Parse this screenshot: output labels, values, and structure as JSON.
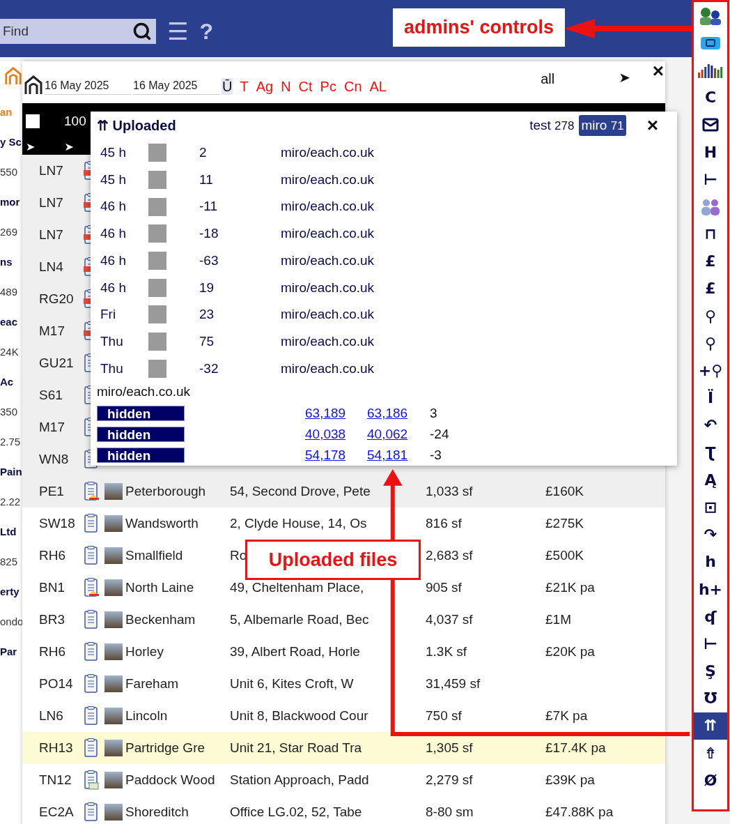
{
  "top_bar": {
    "search": {
      "placeholder": "Find"
    },
    "menu_glyph": "☰",
    "help_glyph": "?"
  },
  "annotations": [
    {
      "kind": "admins",
      "text": "admins' controls"
    },
    {
      "kind": "uploads",
      "text": "Uploaded files"
    }
  ],
  "left_strip": [
    {
      "kind": "accent",
      "text": "an"
    },
    {
      "kind": "heading",
      "text": "y Sc"
    },
    {
      "kind": "value",
      "text": "550"
    },
    {
      "kind": "heading",
      "text": "mor"
    },
    {
      "kind": "value",
      "text": "269"
    },
    {
      "kind": "heading",
      "text": "ns"
    },
    {
      "kind": "value",
      "text": "489"
    },
    {
      "kind": "heading",
      "text": "eac"
    },
    {
      "kind": "value",
      "text": "24K"
    },
    {
      "kind": "heading",
      "text": "Ac"
    },
    {
      "kind": "value",
      "text": "350"
    },
    {
      "kind": "value",
      "text": "2.75"
    },
    {
      "kind": "heading",
      "text": "Pain"
    },
    {
      "kind": "value",
      "text": "2.22"
    },
    {
      "kind": "heading",
      "text": "Ltd"
    },
    {
      "kind": "value",
      "text": "825"
    },
    {
      "kind": "heading",
      "text": "erty"
    },
    {
      "kind": "value",
      "text": "ondo"
    },
    {
      "kind": "heading",
      "text": "Par"
    }
  ],
  "panel": {
    "date_from": "16 May 2025",
    "date_to": "16 May 2025",
    "filters": [
      {
        "label": "Ū",
        "selected": true
      },
      {
        "label": "T",
        "selected": false
      },
      {
        "label": "Ag",
        "selected": false
      },
      {
        "label": "N",
        "selected": false
      },
      {
        "label": "Ct",
        "selected": false
      },
      {
        "label": "Pc",
        "selected": false
      },
      {
        "label": "Cn",
        "selected": false
      },
      {
        "label": "AL",
        "selected": false
      }
    ],
    "scope": "all",
    "go_glyph": "➤",
    "close_glyph": "×",
    "toolbar": {
      "checked": false,
      "count": "100",
      "arrows": [
        "➤",
        "➤"
      ]
    }
  },
  "table": {
    "rows": [
      {
        "postcode": "LN7",
        "kind": "pdf",
        "color": "#efefef"
      },
      {
        "postcode": "LN7",
        "kind": "pdf",
        "color": "#efefef"
      },
      {
        "postcode": "LN7",
        "kind": "pdf",
        "color": "#efefef"
      },
      {
        "postcode": "LN4",
        "kind": "pdf",
        "color": "#efefef"
      },
      {
        "postcode": "RG20",
        "kind": "pdf",
        "color": "#efefef"
      },
      {
        "postcode": "M17",
        "kind": "pdf",
        "color": "#efefef"
      },
      {
        "postcode": "GU21",
        "kind": "plain",
        "color": "#efefef"
      },
      {
        "postcode": "S61",
        "kind": "plain",
        "color": "#efefef"
      },
      {
        "postcode": "M17",
        "kind": "plain",
        "color": "#efefef"
      },
      {
        "postcode": "WN8",
        "kind": "plain",
        "color": "#efefef"
      },
      {
        "postcode": "PE1",
        "kind": "epc",
        "color": "#efefef",
        "town": "Peterborough",
        "address": "54, Second Drove, Pete",
        "size": "1,033 sf",
        "price": "£160K"
      },
      {
        "postcode": "SW18",
        "kind": "plain",
        "color": "#ffffff",
        "town": "Wandsworth",
        "address": "2, Clyde House, 14, Os",
        "size": "816 sf",
        "price": "£275K"
      },
      {
        "postcode": "RH6",
        "kind": "plain",
        "color": "#ffffff",
        "town": "Smallfield",
        "address": "Ro",
        "size": "2,683 sf",
        "price": "£500K"
      },
      {
        "postcode": "BN1",
        "kind": "epc",
        "color": "#ffffff",
        "town": "North Laine",
        "address": "49, Cheltenham Place,",
        "size": "905 sf",
        "price": "£21K pa"
      },
      {
        "postcode": "BR3",
        "kind": "plain",
        "color": "#ffffff",
        "town": "Beckenham",
        "address": "5, Albemarle Road, Bec",
        "size": "4,037 sf",
        "price": "£1M"
      },
      {
        "postcode": "RH6",
        "kind": "plain",
        "color": "#ffffff",
        "town": "Horley",
        "address": "39, Albert Road, Horle",
        "size": "1.3K sf",
        "price": "£20K pa"
      },
      {
        "postcode": "PO14",
        "kind": "plain",
        "color": "#ffffff",
        "town": "Fareham",
        "address": "Unit 6, Kites Croft, W",
        "size": "31,459 sf"
      },
      {
        "postcode": "LN6",
        "kind": "plain",
        "color": "#ffffff",
        "town": "Lincoln",
        "address": "Unit 8, Blackwood Cour",
        "size": "750 sf",
        "price": "£7K pa"
      },
      {
        "postcode": "RH13",
        "kind": "plain",
        "color": "#fdfbd3",
        "town": "Partridge Gre",
        "address": "Unit 21, Star Road Tra",
        "size": "1,305 sf",
        "price": "£17.4K pa"
      },
      {
        "postcode": "TN12",
        "kind": "plan",
        "color": "#ffffff",
        "town": "Paddock Wood",
        "address": "Station Approach, Padd",
        "size": "2,279 sf",
        "price": "£39K pa"
      },
      {
        "postcode": "EC2A",
        "kind": "plain",
        "color": "#ffffff",
        "town": "Shoreditch",
        "address": "Office LG.02, 52, Tabe",
        "size": "8-80 sm",
        "price": "£47.88K pa"
      }
    ]
  },
  "popup": {
    "title_glyph": "⇈",
    "title": "Uploaded",
    "close_glyph": "×",
    "users": [
      {
        "name": "test",
        "count": "278",
        "selected": false
      },
      {
        "name": "miro",
        "count": "71",
        "selected": true
      }
    ],
    "uploads": [
      {
        "time": "45 h",
        "number": "2",
        "source": "miro/each.co.uk"
      },
      {
        "time": "45 h",
        "number": "11",
        "source": "miro/each.co.uk"
      },
      {
        "time": "46 h",
        "number": "-11",
        "source": "miro/each.co.uk"
      },
      {
        "time": "46 h",
        "number": "-18",
        "source": "miro/each.co.uk"
      },
      {
        "time": "46 h",
        "number": "-63",
        "source": "miro/each.co.uk"
      },
      {
        "time": "46 h",
        "number": "19",
        "source": "miro/each.co.uk"
      },
      {
        "time": "Fri",
        "number": "23",
        "source": "miro/each.co.uk"
      },
      {
        "time": "Thu",
        "number": "75",
        "source": "miro/each.co.uk"
      },
      {
        "time": "Thu",
        "number": "-32",
        "source": "miro/each.co.uk"
      }
    ],
    "footer_source": "miro/each.co.uk",
    "hidden_rows": [
      {
        "label": "hidden",
        "link_1": "63,189",
        "link_2": "63,186",
        "count": "3"
      },
      {
        "label": "hidden",
        "link_1": "40,038",
        "link_2": "40,062",
        "count": "-24"
      },
      {
        "label": "hidden",
        "link_1": "54,178",
        "link_2": "54,181",
        "count": "-3"
      }
    ]
  },
  "sidebar": {
    "items": [
      {
        "kind": "people",
        "selected": false
      },
      {
        "kind": "card",
        "selected": false
      },
      {
        "kind": "bars",
        "selected": false
      },
      {
        "kind": "glyph",
        "label": "C",
        "selected": false
      },
      {
        "kind": "mail",
        "selected": false
      },
      {
        "kind": "glyph",
        "label": "H",
        "selected": false
      },
      {
        "kind": "glyph",
        "label": "⊢",
        "selected": false
      },
      {
        "kind": "group",
        "selected": false
      },
      {
        "kind": "glyph",
        "label": "⊓",
        "selected": false
      },
      {
        "kind": "glyph",
        "label": "£",
        "selected": false
      },
      {
        "kind": "glyph",
        "label": "£",
        "selected": false
      },
      {
        "kind": "glyph",
        "label": "⚲",
        "selected": false
      },
      {
        "kind": "glyph",
        "label": "⚲",
        "selected": false
      },
      {
        "kind": "glyph",
        "label": "+⚲",
        "selected": false
      },
      {
        "kind": "glyph",
        "label": "Ï",
        "selected": false
      },
      {
        "kind": "glyph",
        "label": "↶",
        "selected": false
      },
      {
        "kind": "glyph",
        "label": "Ʈ",
        "selected": false
      },
      {
        "kind": "glyph",
        "label": "Ą",
        "selected": false
      },
      {
        "kind": "glyph",
        "label": "⊡",
        "selected": false
      },
      {
        "kind": "glyph",
        "label": "↷",
        "selected": false
      },
      {
        "kind": "glyph",
        "label": "h",
        "selected": false
      },
      {
        "kind": "glyph",
        "label": "h+",
        "selected": false
      },
      {
        "kind": "glyph",
        "label": "ʠ",
        "selected": false
      },
      {
        "kind": "glyph",
        "label": "⊢",
        "selected": false
      },
      {
        "kind": "glyph",
        "label": "Ş",
        "selected": false
      },
      {
        "kind": "glyph",
        "label": "Ʊ",
        "selected": false
      },
      {
        "kind": "glyph",
        "label": "⇈",
        "selected": true
      },
      {
        "kind": "glyph",
        "label": "⇮",
        "selected": false
      },
      {
        "kind": "glyph",
        "label": "Ø",
        "selected": false
      }
    ]
  }
}
